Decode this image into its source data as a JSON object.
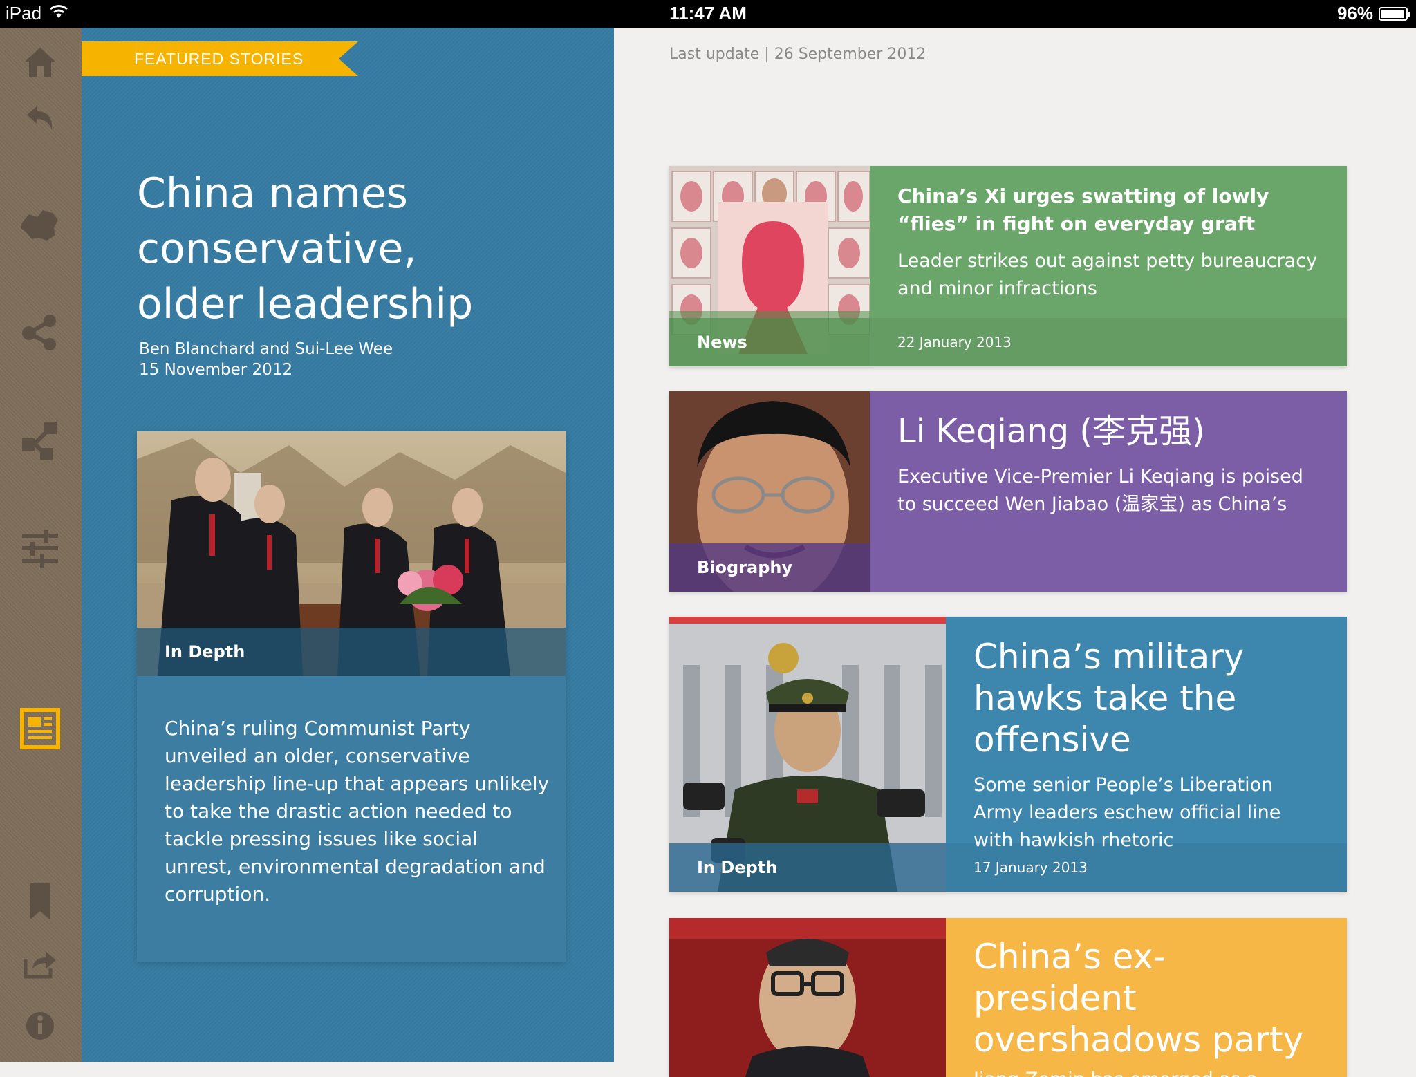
{
  "status_bar": {
    "device": "iPad",
    "time": "11:47 AM",
    "battery": "96%",
    "battery_level": 0.96
  },
  "rail": {
    "active_item": "newspaper",
    "accent": "#f6b400"
  },
  "featured": {
    "ribbon": "FEATURED STORIES",
    "title": "China names conservative, older leadership",
    "byline": "Ben Blanchard and Sui-Lee Wee",
    "date": "15 November 2012",
    "tag": "In Depth",
    "summary": "China’s ruling Communist Party unveiled an older, conservative leadership line-up that appears unlikely to take the drastic action needed to tackle pressing issues like social unrest, environmental degradation and corruption.",
    "color": "#3c7da1"
  },
  "last_update": "Last update | 26 September 2012",
  "stories": [
    {
      "tag": "News",
      "headline": "China’s Xi urges swatting of lowly “flies” in fight on everyday graft",
      "dek": "Leader strikes out against petty bureaucracy and minor infractions",
      "date": "22 January 2013",
      "color": "#6aa56a"
    },
    {
      "tag": "Biography",
      "headline": "Li Keqiang (李克强)",
      "dek": "Executive Vice-Premier Li Keqiang is poised to succeed Wen Jiabao (温家宝) as China’s",
      "date": "",
      "color": "#7b5ea6"
    },
    {
      "tag": "In Depth",
      "headline": "China’s military hawks take the offensive",
      "dek": "Some senior People’s Liberation Army leaders eschew official line with hawkish rhetoric",
      "date": "17 January 2013",
      "color": "#3d86ad"
    },
    {
      "tag": "",
      "headline": "China’s ex-president overshadows party",
      "dek": "Jiang Zemin has emerged as a",
      "date": "",
      "color": "#f6b747"
    }
  ]
}
